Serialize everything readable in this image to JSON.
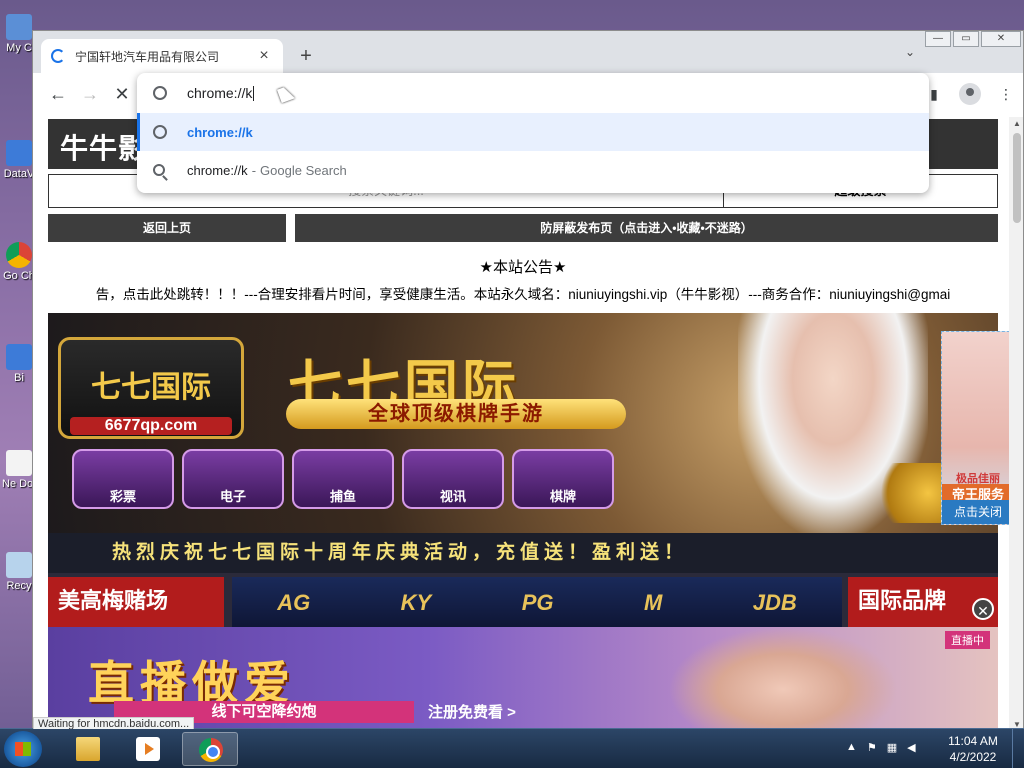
{
  "desktop": {
    "icons": [
      {
        "label": "My C",
        "icon": "computer-icon"
      },
      {
        "label": "DataV",
        "icon": "app-icon"
      },
      {
        "label": "Go Ch",
        "icon": "chrome-icon"
      },
      {
        "label": "Bi",
        "icon": "app-icon"
      },
      {
        "label": "Ne Doc",
        "icon": "document-icon"
      },
      {
        "label": "Recy",
        "icon": "recycle-bin-icon"
      }
    ]
  },
  "browser": {
    "tab": {
      "title": "宁国轩地汽车用品有限公司",
      "close": "×"
    },
    "new_tab": "+",
    "tab_search": "⌄",
    "window_controls": {
      "minimize": "—",
      "maximize": "▭",
      "close": "✕"
    },
    "nav": {
      "back": "←",
      "forward": "→",
      "stop": "✕"
    },
    "omnibox": {
      "typed": "chrome://k",
      "suggestions": [
        {
          "text": "chrome://k",
          "selected": true
        },
        {
          "text": "chrome://k",
          "separator": "-",
          "engine": "Google Search"
        }
      ]
    },
    "status_bubble": "Waiting for hmcdn.baidu.com..."
  },
  "page": {
    "logo": "牛牛影视",
    "search_placeholder": "搜索关键词...",
    "advanced_search": "超级搜索",
    "nav_back": "返回上页",
    "nav_publish": "防屏蔽发布页（点击进入•收藏•不迷路）",
    "notice_title": "★本站公告★",
    "notice_body": "告，点击此处跳转！！！---合理安排看片时间，享受健康生活。本站永久域名：niuniuyingshi.vip（牛牛影视）---商务合作：niuniuyingshi@gmai",
    "banner1": {
      "logo_text": "七七国际",
      "url": "6677qp.com",
      "title": "七七国际",
      "subtitle": "全球顶级棋牌手游",
      "games": [
        "彩票",
        "电子",
        "捕鱼",
        "视讯",
        "棋牌"
      ]
    },
    "ticker": "热烈庆祝七七国际十周年庆典活动，充值送！盈利送！",
    "banner2": {
      "left": "美高梅赌场",
      "right": "国际品牌",
      "providers": [
        "AG",
        "KY",
        "PG",
        "M",
        "JDB"
      ]
    },
    "banner3": {
      "title": "直播做爱",
      "sub": "线下可空降约炮",
      "register": "注册免费看 >",
      "badge": "直播中"
    },
    "float_ad": {
      "line1": "极品佳丽",
      "line2": "帝王服务",
      "close": "点击关闭"
    }
  },
  "taskbar": {
    "time": "11:04 AM",
    "date": "4/2/2022"
  }
}
